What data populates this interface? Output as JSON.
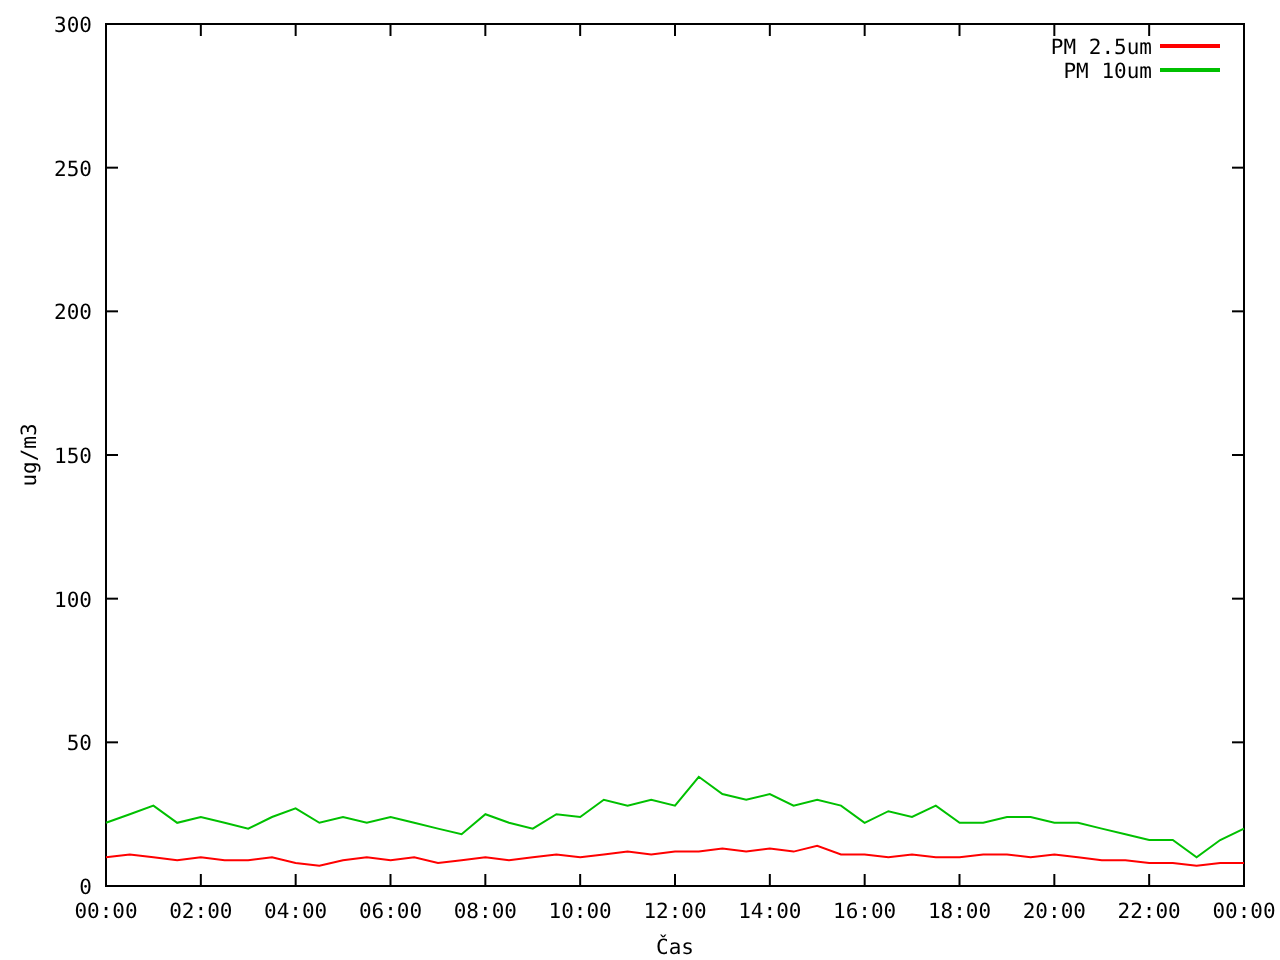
{
  "chart_data": {
    "type": "line",
    "legend": "upper right",
    "xlabel": "Čas",
    "ylabel": "ug/m3",
    "xlim": [
      0,
      24
    ],
    "ylim": [
      0,
      300
    ],
    "xticks": [
      {
        "value": 0,
        "label": "00:00"
      },
      {
        "value": 2,
        "label": "02:00"
      },
      {
        "value": 4,
        "label": "04:00"
      },
      {
        "value": 6,
        "label": "06:00"
      },
      {
        "value": 8,
        "label": "08:00"
      },
      {
        "value": 10,
        "label": "10:00"
      },
      {
        "value": 12,
        "label": "12:00"
      },
      {
        "value": 14,
        "label": "14:00"
      },
      {
        "value": 16,
        "label": "16:00"
      },
      {
        "value": 18,
        "label": "18:00"
      },
      {
        "value": 20,
        "label": "20:00"
      },
      {
        "value": 22,
        "label": "22:00"
      },
      {
        "value": 24,
        "label": "00:00"
      }
    ],
    "yticks": [
      0,
      50,
      100,
      150,
      200,
      250,
      300
    ],
    "x": [
      0,
      0.5,
      1,
      1.5,
      2,
      2.5,
      3,
      3.5,
      4,
      4.5,
      5,
      5.5,
      6,
      6.5,
      7,
      7.5,
      8,
      8.5,
      9,
      9.5,
      10,
      10.5,
      11,
      11.5,
      12,
      12.5,
      13,
      13.5,
      14,
      14.5,
      15,
      15.5,
      16,
      16.5,
      17,
      17.5,
      18,
      18.5,
      19,
      19.5,
      20,
      20.5,
      21,
      21.5,
      22,
      22.5,
      23,
      23.5,
      24
    ],
    "series": [
      {
        "name": "PM 2.5um",
        "color": "#ff0000",
        "values": [
          10,
          11,
          10,
          9,
          10,
          9,
          9,
          10,
          8,
          7,
          9,
          10,
          9,
          10,
          8,
          9,
          10,
          9,
          10,
          11,
          10,
          11,
          12,
          11,
          12,
          12,
          13,
          12,
          13,
          12,
          14,
          11,
          11,
          10,
          11,
          10,
          10,
          11,
          11,
          10,
          11,
          10,
          9,
          9,
          8,
          8,
          7,
          8,
          8
        ]
      },
      {
        "name": "PM 10um",
        "color": "#00c000",
        "values": [
          22,
          25,
          28,
          22,
          24,
          22,
          20,
          24,
          27,
          22,
          24,
          22,
          24,
          22,
          20,
          18,
          25,
          22,
          20,
          25,
          24,
          30,
          28,
          30,
          28,
          38,
          32,
          30,
          32,
          28,
          30,
          28,
          22,
          26,
          24,
          28,
          22,
          22,
          24,
          24,
          22,
          22,
          20,
          18,
          16,
          16,
          10,
          16,
          20
        ]
      }
    ]
  }
}
